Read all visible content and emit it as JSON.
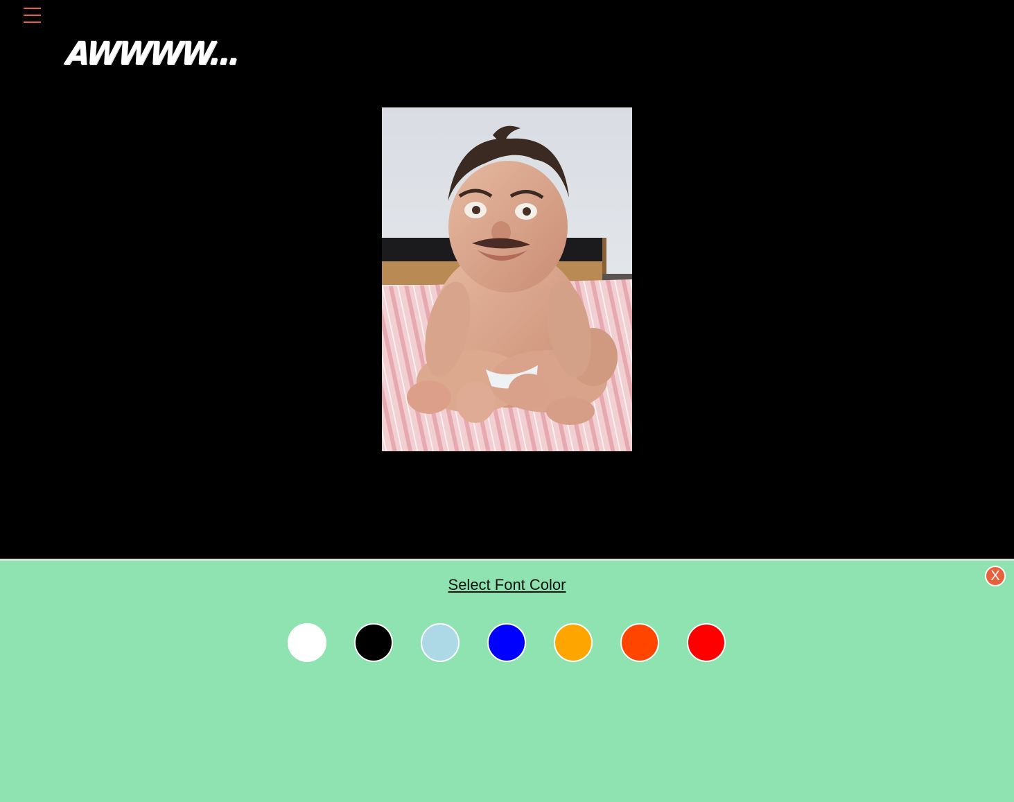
{
  "header": {
    "logo_text": "AWWWW...",
    "menu_icon": "hamburger-menu-icon"
  },
  "image": {
    "alt": ""
  },
  "panel": {
    "title": "Select Font Color",
    "close_label": "X",
    "colors": [
      {
        "name": "white",
        "hex": "#ffffff"
      },
      {
        "name": "black",
        "hex": "#000000"
      },
      {
        "name": "lightblue",
        "hex": "#add8e6"
      },
      {
        "name": "blue",
        "hex": "#0000ff"
      },
      {
        "name": "orange",
        "hex": "#ffa500"
      },
      {
        "name": "orangered",
        "hex": "#ff4500"
      },
      {
        "name": "red",
        "hex": "#ff0000"
      }
    ]
  },
  "theme": {
    "accent": "#e8603c",
    "panel_bg": "#8ee3b0",
    "page_bg": "#000000"
  }
}
